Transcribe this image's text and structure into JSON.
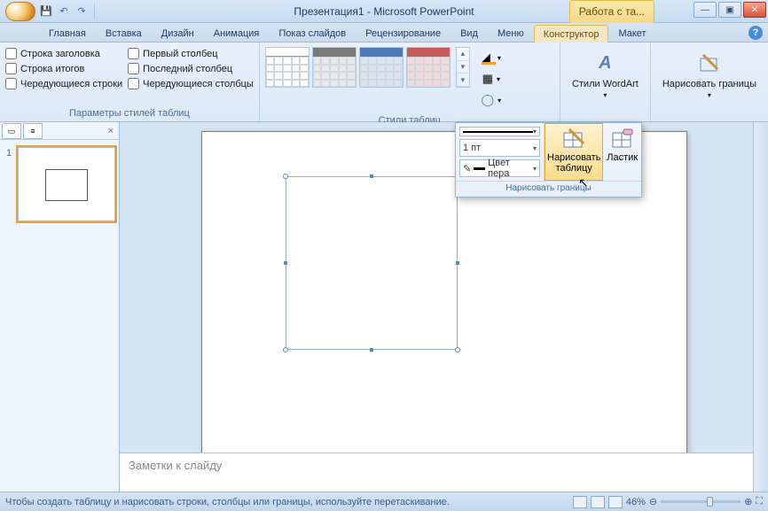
{
  "title": "Презентация1 - Microsoft PowerPoint",
  "context_tab_title": "Работа с та...",
  "tabs": [
    "Главная",
    "Вставка",
    "Дизайн",
    "Анимация",
    "Показ слайдов",
    "Рецензирование",
    "Вид",
    "Меню",
    "Конструктор",
    "Макет"
  ],
  "active_tab_index": 8,
  "ribbon": {
    "group1": {
      "label": "Параметры стилей таблиц",
      "left": [
        "Строка заголовка",
        "Строка итогов",
        "Чередующиеся строки"
      ],
      "right": [
        "Первый столбец",
        "Последний столбец",
        "Чередующиеся столбцы"
      ]
    },
    "group2": {
      "label": "Стили таблиц"
    },
    "wordart": "Стили WordArt",
    "draw_borders": "Нарисовать границы"
  },
  "popup": {
    "weight": "1 пт",
    "pen_color": "Цвет пера",
    "draw_table": "Нарисовать таблицу",
    "eraser": "Ластик",
    "label": "Нарисовать границы"
  },
  "thumb": {
    "num": "1"
  },
  "notes_placeholder": "Заметки к слайду",
  "status": {
    "msg": "Чтобы создать таблицу и нарисовать строки, столбцы или границы, используйте перетаскивание.",
    "zoom": "46%"
  }
}
